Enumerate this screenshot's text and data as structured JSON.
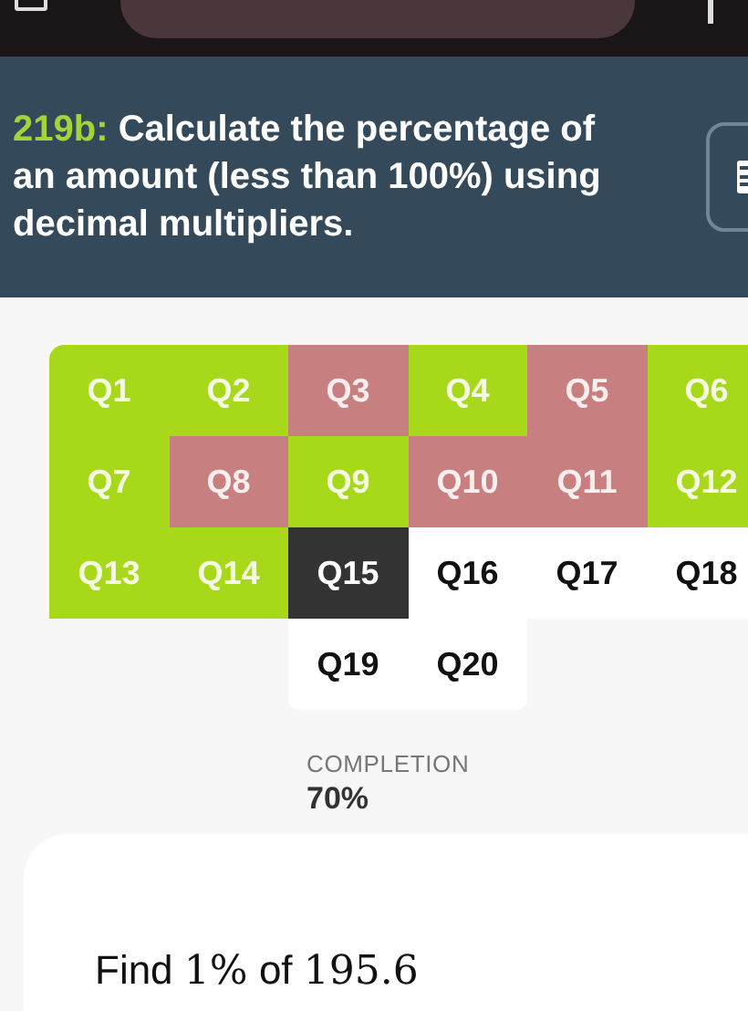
{
  "header": {
    "code": "219b:",
    "title": "Calculate the percentage of an amount (less than 100%) using decimal multipliers."
  },
  "questions": [
    {
      "label": "Q1",
      "kind": "correct"
    },
    {
      "label": "Q2",
      "kind": "correct"
    },
    {
      "label": "Q3",
      "kind": "incorrect"
    },
    {
      "label": "Q4",
      "kind": "correct"
    },
    {
      "label": "Q5",
      "kind": "incorrect"
    },
    {
      "label": "Q6",
      "kind": "correct"
    },
    {
      "label": "Q7",
      "kind": "correct"
    },
    {
      "label": "Q8",
      "kind": "incorrect"
    },
    {
      "label": "Q9",
      "kind": "correct"
    },
    {
      "label": "Q10",
      "kind": "incorrect"
    },
    {
      "label": "Q11",
      "kind": "incorrect"
    },
    {
      "label": "Q12",
      "kind": "correct"
    },
    {
      "label": "Q13",
      "kind": "correct"
    },
    {
      "label": "Q14",
      "kind": "correct"
    },
    {
      "label": "Q15",
      "kind": "current"
    },
    {
      "label": "Q16",
      "kind": "unanswered"
    },
    {
      "label": "Q17",
      "kind": "unanswered"
    },
    {
      "label": "Q18",
      "kind": "unanswered"
    },
    {
      "label": "Q19",
      "kind": "unanswered"
    },
    {
      "label": "Q20",
      "kind": "unanswered"
    }
  ],
  "completion": {
    "label": "COMPLETION",
    "value": "70%"
  },
  "question": [
    {
      "kind": "text",
      "text": "Find "
    },
    {
      "kind": "math",
      "text": "1%"
    },
    {
      "kind": "text",
      "text": " of "
    },
    {
      "kind": "math",
      "text": "195.6"
    }
  ]
}
